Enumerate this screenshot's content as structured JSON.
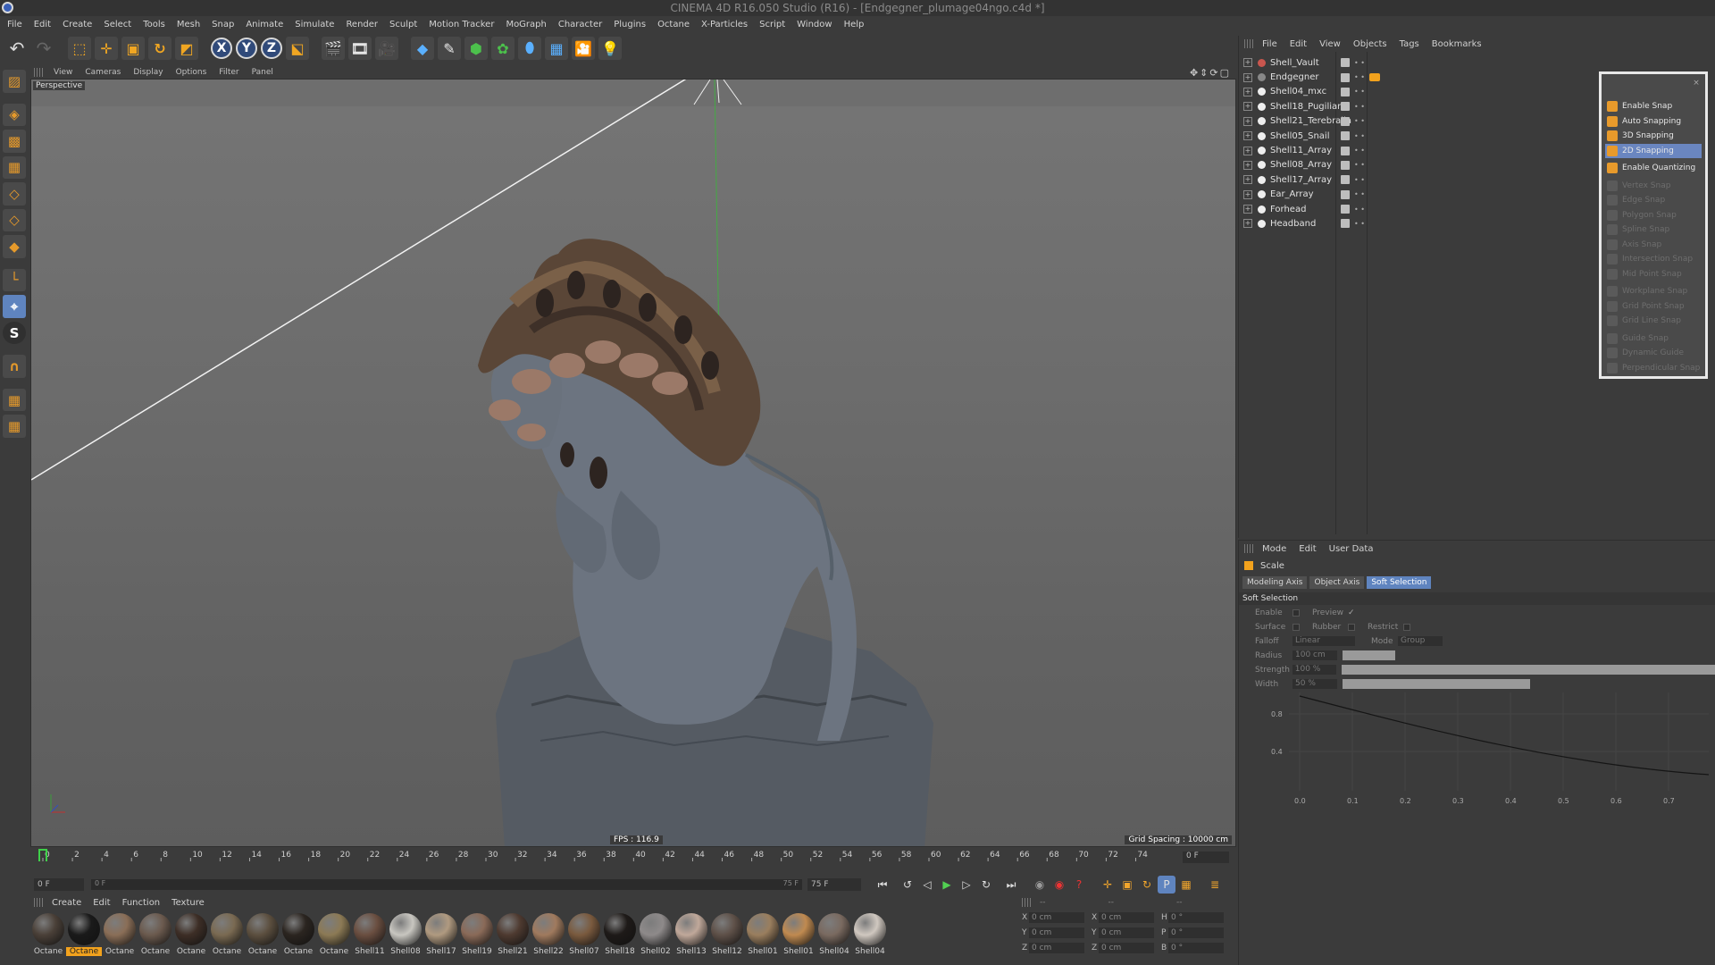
{
  "window": {
    "title": "CINEMA 4D R16.050 Studio (R16) - [Endgegner_plumage04ngo.c4d *]"
  },
  "menu": [
    "File",
    "Edit",
    "Create",
    "Select",
    "Tools",
    "Mesh",
    "Snap",
    "Animate",
    "Simulate",
    "Render",
    "Sculpt",
    "Motion Tracker",
    "MoGraph",
    "Character",
    "Plugins",
    "Octane",
    "X-Particles",
    "Script",
    "Window",
    "Help"
  ],
  "toolbar": {
    "x_label": "X",
    "y_label": "Y",
    "z_label": "Z"
  },
  "viewport": {
    "menu": [
      "View",
      "Cameras",
      "Display",
      "Options",
      "Filter",
      "Panel"
    ],
    "camera_label": "Perspective",
    "fps": "FPS : 116.9",
    "grid_spacing": "Grid Spacing : 10000 cm"
  },
  "timeline": {
    "ticks": [
      "0",
      "2",
      "4",
      "6",
      "8",
      "10",
      "12",
      "14",
      "16",
      "18",
      "20",
      "22",
      "24",
      "26",
      "28",
      "30",
      "32",
      "34",
      "36",
      "38",
      "40",
      "42",
      "44",
      "46",
      "48",
      "50",
      "52",
      "54",
      "56",
      "58",
      "60",
      "62",
      "64",
      "66",
      "68",
      "70",
      "72",
      "74"
    ],
    "end_field": "0 F",
    "start_frame": "0 F",
    "range_start": "0 F",
    "range_end": "75 F",
    "end_frame": "75 F"
  },
  "material_manager": {
    "menu": [
      "Create",
      "Edit",
      "Function",
      "Texture"
    ],
    "materials": [
      {
        "name": "Octane",
        "color": "#4a4038",
        "active": false
      },
      {
        "name": "Octane",
        "color": "#1a1a1a",
        "active": true
      },
      {
        "name": "Octane",
        "color": "#8a6e57",
        "active": false
      },
      {
        "name": "Octane",
        "color": "#6b5a4e",
        "active": false
      },
      {
        "name": "Octane",
        "color": "#3d2e26",
        "active": false
      },
      {
        "name": "Octane",
        "color": "#7a6a52",
        "active": false
      },
      {
        "name": "Octane",
        "color": "#5c4f3f",
        "active": false
      },
      {
        "name": "Octane",
        "color": "#2b2520",
        "active": false
      },
      {
        "name": "Octane",
        "color": "#8c7a55",
        "active": false
      },
      {
        "name": "Shell11",
        "color": "#6a4e40",
        "active": false
      },
      {
        "name": "Shell08",
        "color": "#c8c6c0",
        "active": false
      },
      {
        "name": "Shell17",
        "color": "#b09a80",
        "active": false
      },
      {
        "name": "Shell19",
        "color": "#8a6a58",
        "active": false
      },
      {
        "name": "Shell21",
        "color": "#4e3a30",
        "active": false
      },
      {
        "name": "Shell22",
        "color": "#a07a5e",
        "active": false
      },
      {
        "name": "Shell07",
        "color": "#7a5a3e",
        "active": false
      },
      {
        "name": "Shell18",
        "color": "#1e1a18",
        "active": false
      },
      {
        "name": "Shell02",
        "color": "#8e8a8a",
        "active": false
      },
      {
        "name": "Shell13",
        "color": "#c0a89a",
        "active": false
      },
      {
        "name": "Shell12",
        "color": "#5e5048",
        "active": false
      },
      {
        "name": "Shell01",
        "color": "#9a7e5e",
        "active": false
      },
      {
        "name": "Shell01",
        "color": "#c08a50",
        "active": false
      },
      {
        "name": "Shell04",
        "color": "#7a6a60",
        "active": false
      },
      {
        "name": "Shell04",
        "color": "#d0c8c0",
        "active": false
      }
    ]
  },
  "coordinates": {
    "rows": [
      {
        "a": "X",
        "av": "0 cm",
        "b": "X",
        "bv": "0 cm",
        "c": "H",
        "cv": "0 °"
      },
      {
        "a": "Y",
        "av": "0 cm",
        "b": "Y",
        "bv": "0 cm",
        "c": "P",
        "cv": "0 °"
      },
      {
        "a": "Z",
        "av": "0 cm",
        "b": "Z",
        "bv": "0 cm",
        "c": "B",
        "cv": "0 °"
      }
    ]
  },
  "object_manager": {
    "menu": [
      "File",
      "Edit",
      "View",
      "Objects",
      "Tags",
      "Bookmarks"
    ],
    "objects": [
      "Shell_Vault",
      "Endgegner",
      "Shell04_mxc",
      "Shell18_Pugiliana",
      "Shell21_Terebralia",
      "Shell05_Snail",
      "Shell11_Array",
      "Shell08_Array",
      "Shell17_Array",
      "Ear_Array",
      "Forhead",
      "Headband"
    ]
  },
  "snap_palette": {
    "items": [
      {
        "label": "Enable Snap",
        "state": "on"
      },
      {
        "label": "Auto Snapping",
        "state": "on"
      },
      {
        "label": "3D Snapping",
        "state": "on"
      },
      {
        "label": "2D Snapping",
        "state": "highlight"
      },
      {
        "label": "Enable Quantizing",
        "state": "on"
      },
      {
        "label": "Vertex Snap",
        "state": "off"
      },
      {
        "label": "Edge Snap",
        "state": "off"
      },
      {
        "label": "Polygon Snap",
        "state": "off"
      },
      {
        "label": "Spline Snap",
        "state": "off"
      },
      {
        "label": "Axis Snap",
        "state": "off"
      },
      {
        "label": "Intersection Snap",
        "state": "off"
      },
      {
        "label": "Mid Point Snap",
        "state": "off"
      },
      {
        "label": "Workplane Snap",
        "state": "off"
      },
      {
        "label": "Grid Point Snap",
        "state": "off"
      },
      {
        "label": "Grid Line Snap",
        "state": "off"
      },
      {
        "label": "Guide Snap",
        "state": "off"
      },
      {
        "label": "Dynamic Guide",
        "state": "off"
      },
      {
        "label": "Perpendicular Snap",
        "state": "off"
      }
    ]
  },
  "attribute_manager": {
    "menu": [
      "Mode",
      "Edit",
      "User Data"
    ],
    "object": "Scale",
    "tabs": [
      "Modeling Axis",
      "Object Axis",
      "Soft Selection"
    ],
    "section": "Soft Selection",
    "enable_label": "Enable",
    "preview_label": "Preview",
    "preview_mark": "✓",
    "surface_label": "Surface",
    "rubber_label": "Rubber",
    "restrict_label": "Restrict",
    "falloff_label": "Falloff",
    "falloff_value": "Linear",
    "mode_label": "Mode",
    "mode_value": "Group",
    "radius_label": "Radius",
    "radius_value": "100 cm",
    "radius_fraction": 0.14,
    "strength_label": "Strength",
    "strength_value": "100 %",
    "strength_fraction": 1.0,
    "width_label": "Width",
    "width_value": "50 %",
    "width_fraction": 0.5,
    "curve_x_ticks": [
      "0.0",
      "0.1",
      "0.2",
      "0.3",
      "0.4",
      "0.5",
      "0.6",
      "0.7"
    ],
    "curve_y_ticks": [
      "0.8",
      "0.4"
    ]
  }
}
